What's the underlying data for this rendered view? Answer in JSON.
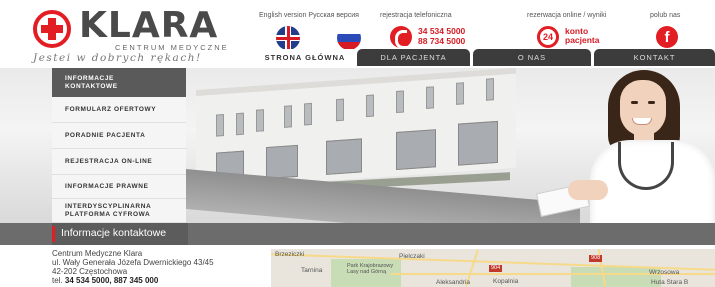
{
  "brand": {
    "name": "KLARA",
    "subtitle": "CENTRUM MEDYCZNE",
    "tagline": "Jestei w dobrych rękach!"
  },
  "header": {
    "languages_label": "English version Русская версия",
    "phone": {
      "label": "rejestracja telefoniczna",
      "numbers": [
        "34 534 5000",
        "88 734 5000"
      ]
    },
    "reservation": {
      "label": "rezerwacja online / wyniki",
      "badge": "24",
      "link_line1": "konto",
      "link_line2": "pacjenta"
    },
    "facebook": {
      "label": "polub nas",
      "icon_glyph": "f"
    }
  },
  "nav": {
    "items": [
      {
        "label": "STRONA GŁÓWNA",
        "state": "active"
      },
      {
        "label": "DLA PACJENTA",
        "state": "dark"
      },
      {
        "label": "O NAS",
        "state": "dark"
      },
      {
        "label": "KONTAKT",
        "state": "dark"
      }
    ]
  },
  "sidebar": {
    "items": [
      {
        "label": "INFORMACJE KONTAKTOWE",
        "active": true
      },
      {
        "label": "FORMULARZ OFERTOWY",
        "active": false
      },
      {
        "label": "PORADNIE PACJENTA",
        "active": false
      },
      {
        "label": "REJESTRACJA ON-LINE",
        "active": false
      },
      {
        "label": "INFORMACJE PRAWNE",
        "active": false
      },
      {
        "label": "INTERDYSCYPLINARNA PLATFORMA CYFROWA",
        "active": false
      }
    ]
  },
  "content": {
    "title": "Informacje kontaktowe",
    "address_lines": [
      "Centrum Medyczne Klara",
      "ul. Wały Generała Józefa Dwernickiego 43/45",
      "42-202 Częstochowa"
    ],
    "tel_prefix": "tel. ",
    "tel_numbers": "34 534 5000, 887 345 000"
  },
  "map": {
    "labels": [
      "Brzeziczki",
      "Pielczaki",
      "Park Krajobrazowy Lasy nad Górną",
      "Tarnina",
      "Aleksandria",
      "Kopalnia",
      "Wrzosowa",
      "Huta Stara B"
    ],
    "shields": [
      "904",
      "908"
    ]
  },
  "colors": {
    "brand_red": "#e31d24",
    "nav_dark": "#3c3c3c",
    "sidebar_active": "#5a5a5a",
    "content_bar": "#6c6c6c"
  }
}
